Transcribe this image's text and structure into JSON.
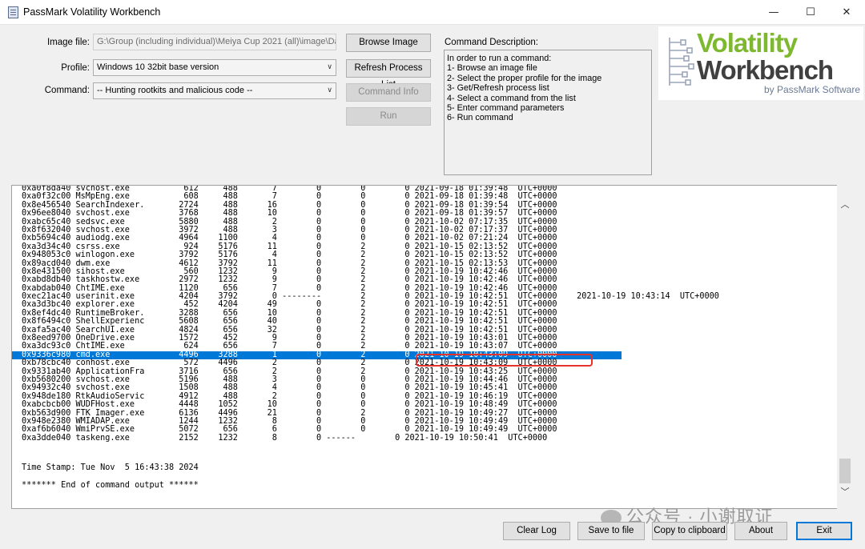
{
  "window": {
    "title": "PassMark Volatility Workbench",
    "minimize_glyph": "—",
    "maximize_glyph": "☐",
    "close_glyph": "✕"
  },
  "form": {
    "image_file_label": "Image file:",
    "image_file_value": "G:\\Group (including individual)\\Meiya Cup 2021 (all)\\image\\DaK F",
    "profile_label": "Profile:",
    "profile_value": "Windows 10 32bit base version",
    "command_label": "Command:",
    "command_value": "-- Hunting rootkits and malicious code --"
  },
  "buttons": {
    "browse_image": "Browse Image",
    "refresh_process_list": "Refresh Process List",
    "command_info": "Command Info",
    "run": "Run",
    "clear_log": "Clear Log",
    "save_to_file": "Save to file",
    "copy_to_clipboard": "Copy to clipboard",
    "about": "About",
    "exit": "Exit"
  },
  "description": {
    "label": "Command Description:",
    "lines": [
      "In order to run a command:",
      "1- Browse an image file",
      "2- Select the proper profile for the image",
      "3- Get/Refresh process list",
      "4- Select a command from the list",
      "5- Enter command parameters",
      "6- Run command"
    ]
  },
  "logo": {
    "line1": "Volatility",
    "line2": "Workbench",
    "byline": "by PassMark Software"
  },
  "output": {
    "selected_index": 21,
    "lines": [
      "0xa0f8da40 svchost.exe           612     488       7        0        0        0 2021-09-18 01:39:48  UTC+0000",
      "0xa0f32c00 MsMpEng.exe           608     488       7        0        0        0 2021-09-18 01:39:48  UTC+0000",
      "0x8e456540 SearchIndexer.       2724     488      16        0        0        0 2021-09-18 01:39:54  UTC+0000",
      "0x96ee8040 svchost.exe          3768     488      10        0        0        0 2021-09-18 01:39:57  UTC+0000",
      "0xabc65c40 sedsvc.exe           5880     488       2        0        0        0 2021-10-02 07:17:35  UTC+0000",
      "0x8f632040 svchost.exe          3972     488       3        0        0        0 2021-10-02 07:17:37  UTC+0000",
      "0xb5694c40 audiodg.exe          4964    1100       4        0        0        0 2021-10-02 07:21:24  UTC+0000",
      "0xa3d34c40 csrss.exe             924    5176      11        0        2        0 2021-10-15 02:13:52  UTC+0000",
      "0x948053c0 winlogon.exe         3792    5176       4        0        2        0 2021-10-15 02:13:52  UTC+0000",
      "0x89acd040 dwm.exe              4612    3792      11        0        2        0 2021-10-15 02:13:53  UTC+0000",
      "0x8e431500 sihost.exe            560    1232       9        0        2        0 2021-10-19 10:42:46  UTC+0000",
      "0xabd8db40 taskhostw.exe        2972    1232       9        0        2        0 2021-10-19 10:42:46  UTC+0000",
      "0xabdab040 ChtIME.exe           1120     656       7        0        2        0 2021-10-19 10:42:46  UTC+0000",
      "0xec21ac40 userinit.exe         4204    3792       0 --------        2        0 2021-10-19 10:42:51  UTC+0000    2021-10-19 10:43:14  UTC+0000",
      "0xa3d3bc40 explorer.exe          452    4204      49        0        2        0 2021-10-19 10:42:51  UTC+0000",
      "0x8ef4dc40 RuntimeBroker.       3288     656      10        0        2        0 2021-10-19 10:42:51  UTC+0000",
      "0x8f6494c0 ShellExperienc       5608     656      40        0        2        0 2021-10-19 10:42:51  UTC+0000",
      "0xafa5ac40 SearchUI.exe         4824     656      32        0        2        0 2021-10-19 10:42:51  UTC+0000",
      "0x8eed9700 OneDrive.exe         1572     452       9        0        2        0 2021-10-19 10:43:01  UTC+0000",
      "0xa3dc93c0 ChtIME.exe            624     656       7        0        2        0 2021-10-19 10:43:07  UTC+0000",
      "0x9336c980 cmd.exe              4496    3288       1        0        2        0 2021-10-19 10:43:09  UTC+0000",
      "0xb78cbc40 conhost.exe           572    4496       2        0        2        0 2021-10-19 10:43:09  UTC+0000",
      "0x9331ab40 ApplicationFra       3716     656       2        0        2        0 2021-10-19 10:43:25  UTC+0000",
      "0xb5680200 svchost.exe          5196     488       3        0        0        0 2021-10-19 10:44:46  UTC+0000",
      "0x94932c40 svchost.exe          1508     488       4        0        0        0 2021-10-19 10:45:41  UTC+0000",
      "0x948de180 RtkAudioServic       4912     488       2        0        0        0 2021-10-19 10:46:19  UTC+0000",
      "0xabcbcb00 WUDFHost.exe         4448    1052      10        0        0        0 2021-10-19 10:48:49  UTC+0000",
      "0xb563d900 FTK Imager.exe       6136    4496      21        0        2        0 2021-10-19 10:49:27  UTC+0000",
      "0x948e2380 WMIADAP.exe          1244    1232       8        0        0        0 2021-10-19 10:49:49  UTC+0000",
      "0xaf6b6040 WmiPrvSE.exe         5072     656       6        0        0        0 2021-10-19 10:49:49  UTC+0000",
      "0xa3dde040 taskeng.exe          2152    1232       8        0 ------        0 2021-10-19 10:50:41  UTC+0000"
    ],
    "timestamp_line": "Time Stamp: Tue Nov  5 16:43:38 2024",
    "end_line": "******* End of command output ******"
  },
  "scrollbar": {
    "up_glyph": "︿",
    "down_glyph": "﹀"
  },
  "watermark": {
    "text": "公众号 · 小谢取证"
  }
}
